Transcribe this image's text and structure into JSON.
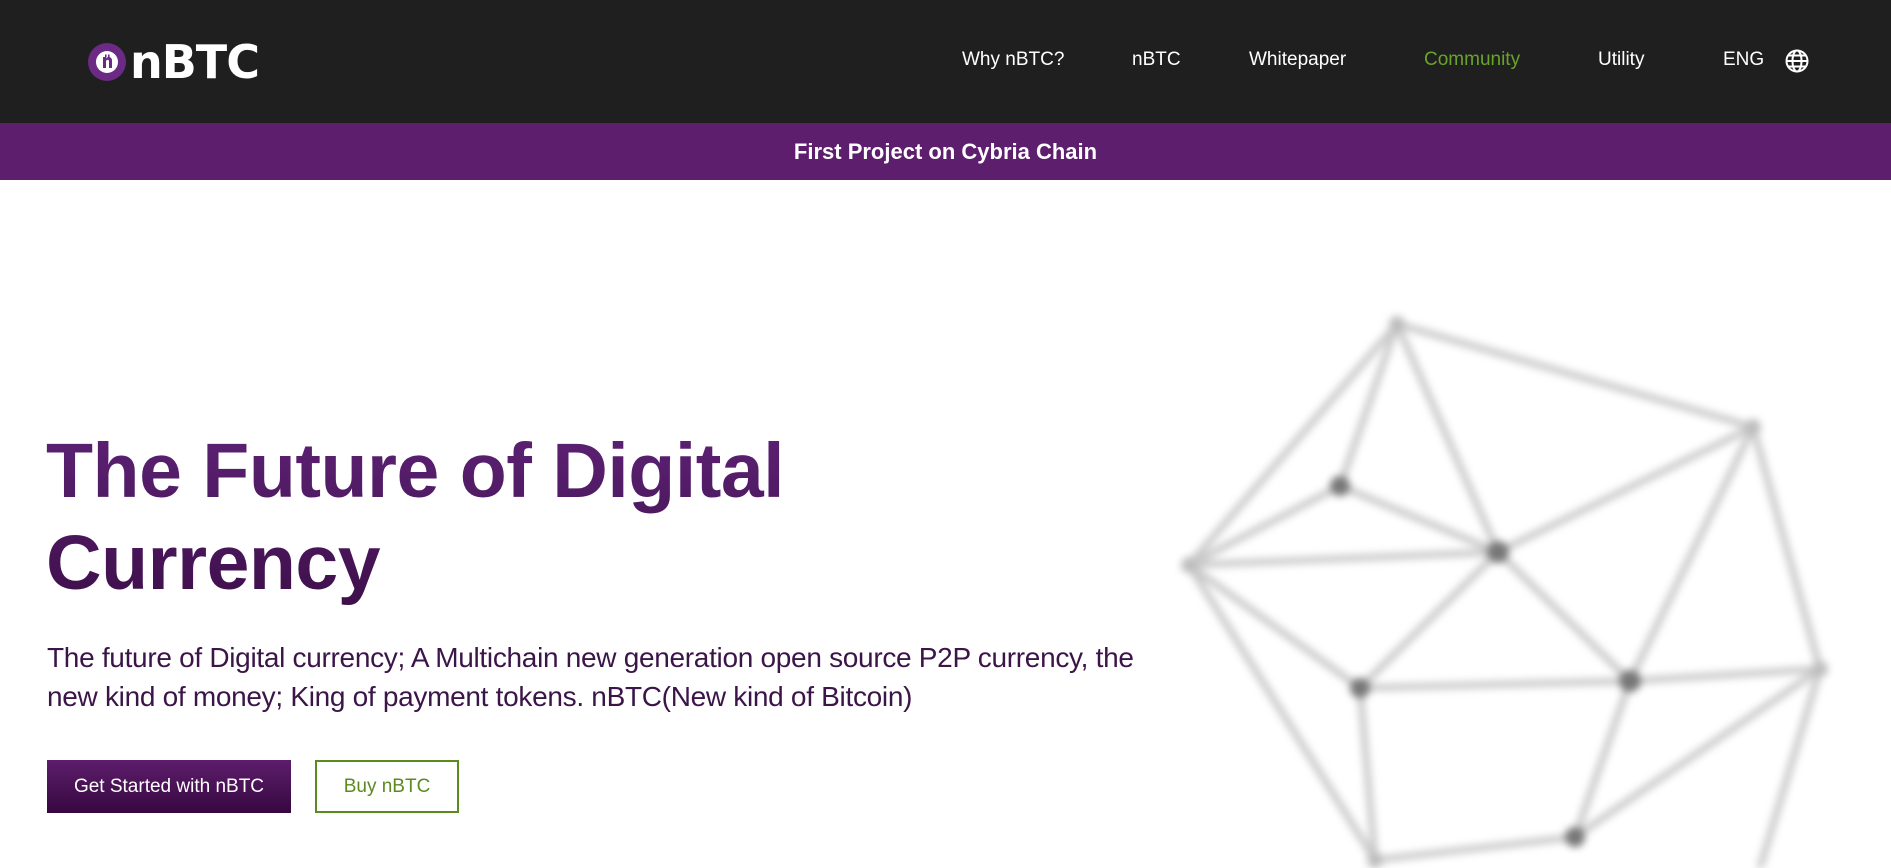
{
  "header": {
    "logo_text": "nBTC",
    "nav": [
      {
        "label": "Why nBTC?"
      },
      {
        "label": "nBTC"
      },
      {
        "label": "Whitepaper"
      },
      {
        "label": "Community"
      },
      {
        "label": "Utility"
      },
      {
        "label": "ENG"
      }
    ],
    "active_nav": "Community",
    "globe_icon": "globe-icon"
  },
  "banner": {
    "text": "First Project on Cybria Chain"
  },
  "hero": {
    "title": "The Future of Digital Currency",
    "subtitle": "The future of Digital currency; A Multichain new generation open source P2P currency, the new kind of money; King of payment tokens. nBTC(New kind of Bitcoin)",
    "primary_button": "Get Started with nBTC",
    "secondary_button": "Buy nBTC",
    "graphic_icon": "network-graph-icon"
  },
  "colors": {
    "header_bg": "#1f1f1f",
    "banner_bg": "#5e1e6e",
    "brand_purple": "#5a1f6e",
    "accent_green": "#6aa32a"
  }
}
